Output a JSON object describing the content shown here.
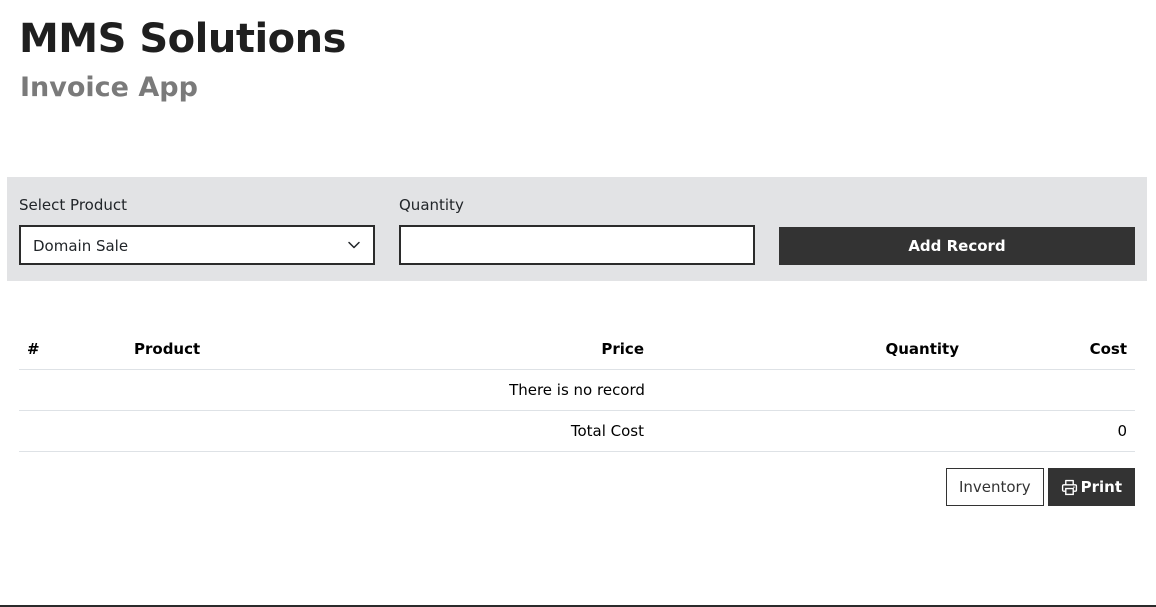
{
  "header": {
    "title": "MMS Solutions",
    "subtitle": "Invoice App"
  },
  "form": {
    "product_label": "Select Product",
    "product_selected": "Domain Sale",
    "quantity_label": "Quantity",
    "quantity_value": "",
    "add_button_label": "Add Record"
  },
  "table": {
    "columns": [
      "#",
      "Product",
      "Price",
      "Quantity",
      "Cost"
    ],
    "empty_message": "There is no record",
    "total_label": "Total Cost",
    "total_value": "0"
  },
  "actions": {
    "inventory_label": "Inventory",
    "print_label": "Print"
  },
  "icons": {
    "select_chevron": "chevron-down-icon",
    "print": "printer-icon"
  },
  "colors": {
    "panel_background": "#e2e3e5",
    "primary_button": "#333333",
    "title_text": "#1f1f1f",
    "subtitle_text": "#7a7a7a"
  }
}
